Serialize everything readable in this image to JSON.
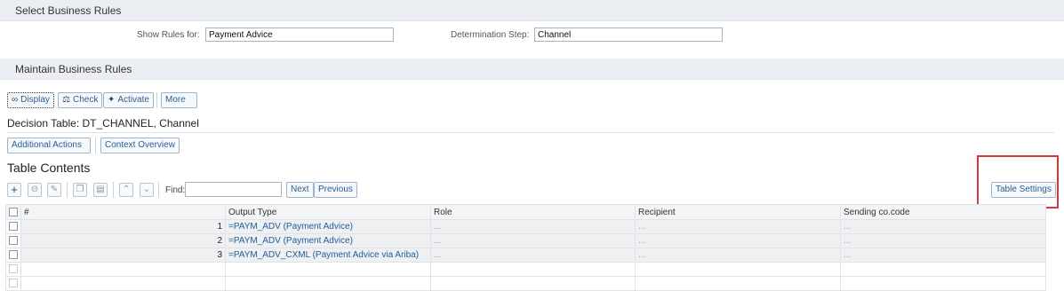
{
  "select_section": {
    "title": "Select Business Rules",
    "show_rules_label": "Show Rules for:",
    "show_rules_value": "Payment Advice",
    "determination_label": "Determination Step:",
    "determination_value": "Channel"
  },
  "maintain_section": {
    "title": "Maintain Business Rules"
  },
  "toolbar": {
    "display_label": "Display",
    "check_label": "Check",
    "activate_label": "Activate",
    "more_label": "More"
  },
  "decision_table_title": "Decision Table: DT_CHANNEL, Channel",
  "sub_toolbar": {
    "additional_actions_label": "Additional Actions",
    "context_overview_label": "Context Overview"
  },
  "table_contents": {
    "title": "Table Contents",
    "find_label": "Find:",
    "find_value": "",
    "next_label": "Next",
    "previous_label": "Previous",
    "table_settings_label": "Table Settings"
  },
  "table": {
    "headers": [
      "#",
      "Output Type",
      "Role",
      "Recipient",
      "Sending co.code"
    ],
    "rows": [
      {
        "num": "1",
        "output_type": "=PAYM_ADV (Payment Advice)",
        "role": "...",
        "recipient": "...",
        "sending": "..."
      },
      {
        "num": "2",
        "output_type": "=PAYM_ADV (Payment Advice)",
        "role": "...",
        "recipient": "...",
        "sending": "..."
      },
      {
        "num": "3",
        "output_type": "=PAYM_ADV_CXML (Payment Advice via Ariba)",
        "role": "...",
        "recipient": "...",
        "sending": "..."
      }
    ]
  },
  "colors": {
    "highlight": "#d9383a",
    "link": "#1f5c99",
    "header_bg": "#ebeff4"
  }
}
